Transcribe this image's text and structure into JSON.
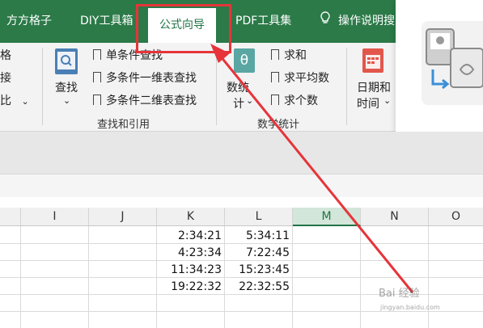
{
  "tabs": {
    "t1": "方方格子",
    "t2": "DIY工具箱",
    "t3": "公式向导",
    "t4": "PDF工具集",
    "t5": "操作说明搜"
  },
  "ribbon": {
    "edge1": "格",
    "edge2": "接",
    "edge3": "比",
    "edge_dropdown": "⌄",
    "lookup_btn": "查找",
    "lookup_dropdown": "⌄",
    "single_lookup": "单条件查找",
    "multi_1d_lookup": "多条件一维表查找",
    "multi_2d_lookup": "多条件二维表查找",
    "group_lookup": "查找和引用",
    "stats_btn_l1": "数统",
    "stats_btn_l2": "计",
    "stats_dropdown": "⌄",
    "sum": "求和",
    "avg": "求平均数",
    "count": "求个数",
    "group_stats": "数学统计",
    "date_btn_l1": "日期和",
    "date_btn_l2": "时间",
    "date_dropdown": "⌄"
  },
  "columns": [
    "I",
    "J",
    "K",
    "L",
    "M",
    "N",
    "O"
  ],
  "cells": {
    "K": [
      "2:34:21",
      "4:23:34",
      "11:34:23",
      "19:22:32"
    ],
    "L": [
      "5:34:11",
      "7:22:45",
      "15:23:45",
      "22:32:55"
    ]
  },
  "watermark": "Bai 经验",
  "watermark_url": "jingyan.baidu.com",
  "colors": {
    "ribbon_green": "#2b7a48",
    "excel_green": "#217346",
    "highlight_red": "#e6343a"
  }
}
